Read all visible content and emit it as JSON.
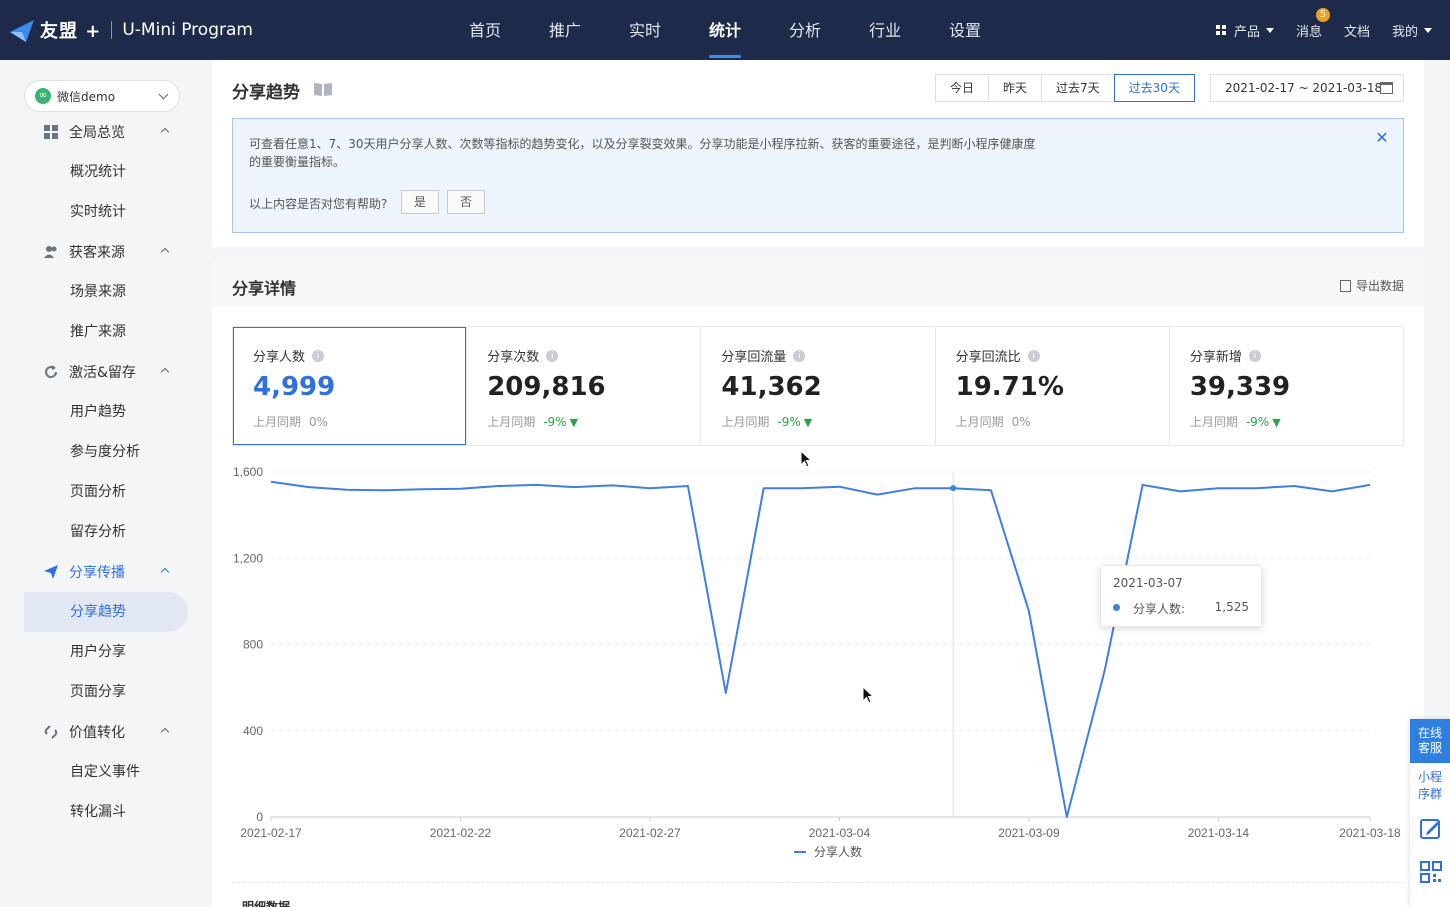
{
  "brand": {
    "name": "友盟 +",
    "product": "U-Mini Program"
  },
  "nav": {
    "items": [
      "首页",
      "推广",
      "实时",
      "统计",
      "分析",
      "行业",
      "设置"
    ],
    "active_index": 3
  },
  "top_right": {
    "product": "产品",
    "message": "消息",
    "message_badge": "5",
    "docs": "文档",
    "mine": "我的"
  },
  "sidebar": {
    "app_name": "微信demo",
    "groups": [
      {
        "label": "全局总览",
        "icon": "grid-icon",
        "subs": [
          "概况统计",
          "实时统计"
        ]
      },
      {
        "label": "获客来源",
        "icon": "users-icon",
        "subs": [
          "场景来源",
          "推广来源"
        ]
      },
      {
        "label": "激活&留存",
        "icon": "refresh-icon",
        "subs": [
          "用户趋势",
          "参与度分析",
          "页面分析",
          "留存分析"
        ]
      },
      {
        "label": "分享传播",
        "icon": "send-icon",
        "subs": [
          "分享趋势",
          "用户分享",
          "页面分享"
        ]
      },
      {
        "label": "价值转化",
        "icon": "link-icon",
        "subs": [
          "自定义事件",
          "转化漏斗"
        ]
      }
    ],
    "active_group": "分享传播",
    "active_item": "分享趋势"
  },
  "header": {
    "title": "分享趋势",
    "ranges": [
      "今日",
      "昨天",
      "过去7天",
      "过去30天"
    ],
    "active_range": "过去30天",
    "date_range": "2021-02-17 ~ 2021-03-18"
  },
  "tip": {
    "text": "可查看任意1、7、30天用户分享人数、次数等指标的趋势变化，以及分享裂变效果。分享功能是小程序拉新、获客的重要途径，是判断小程序健康度的重要衡量指标。",
    "question": "以上内容是否对您有帮助?",
    "yes": "是",
    "no": "否"
  },
  "detail": {
    "title": "分享详情",
    "export": "导出数据",
    "compare_label": "上月同期",
    "stats": [
      {
        "label": "分享人数",
        "value": "4,999",
        "change": "0%",
        "down": false
      },
      {
        "label": "分享次数",
        "value": "209,816",
        "change": "-9%",
        "down": true
      },
      {
        "label": "分享回流量",
        "value": "41,362",
        "change": "-9%",
        "down": true
      },
      {
        "label": "分享回流比",
        "value": "19.71%",
        "change": "0%",
        "down": false
      },
      {
        "label": "分享新增",
        "value": "39,339",
        "change": "-9%",
        "down": true
      }
    ],
    "more_title": "明细数据"
  },
  "chart_data": {
    "type": "line",
    "x": [
      "2021-02-17",
      "2021-02-18",
      "2021-02-19",
      "2021-02-20",
      "2021-02-21",
      "2021-02-22",
      "2021-02-23",
      "2021-02-24",
      "2021-02-25",
      "2021-02-26",
      "2021-02-27",
      "2021-02-28",
      "2021-03-01",
      "2021-03-02",
      "2021-03-03",
      "2021-03-04",
      "2021-03-05",
      "2021-03-06",
      "2021-03-07",
      "2021-03-08",
      "2021-03-09",
      "2021-03-10",
      "2021-03-11",
      "2021-03-12",
      "2021-03-13",
      "2021-03-14",
      "2021-03-15",
      "2021-03-16",
      "2021-03-17",
      "2021-03-18"
    ],
    "tick_labels": [
      "2021-02-17",
      "2021-02-22",
      "2021-02-27",
      "2021-03-04",
      "2021-03-09",
      "2021-03-14",
      "2021-03-18"
    ],
    "y_ticks": [
      "0",
      "400",
      "800",
      "1,200",
      "1,600"
    ],
    "ylim": [
      0,
      1600
    ],
    "series": [
      {
        "name": "分享人数",
        "color": "#3f7fe0",
        "values": [
          1555,
          1530,
          1518,
          1515,
          1520,
          1522,
          1535,
          1540,
          1530,
          1538,
          1525,
          1535,
          575,
          1525,
          1525,
          1532,
          1495,
          1525,
          1525,
          1515,
          955,
          0,
          680,
          1540,
          1510,
          1525,
          1525,
          1535,
          1510,
          1540
        ]
      }
    ],
    "tooltip": {
      "date": "2021-03-07",
      "name": "分享人数:",
      "value": "1,525"
    },
    "grid": true,
    "legend": "bottom-center"
  },
  "float_bar": {
    "service": "在线客服",
    "groups": "小程序群"
  }
}
